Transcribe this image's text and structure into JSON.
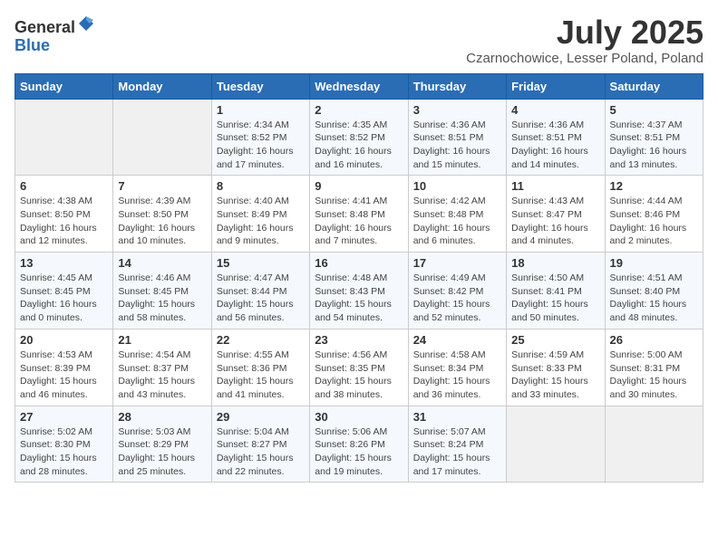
{
  "header": {
    "logo_general": "General",
    "logo_blue": "Blue",
    "month": "July 2025",
    "location": "Czarnochowice, Lesser Poland, Poland"
  },
  "days_of_week": [
    "Sunday",
    "Monday",
    "Tuesday",
    "Wednesday",
    "Thursday",
    "Friday",
    "Saturday"
  ],
  "weeks": [
    [
      {
        "day": "",
        "empty": true
      },
      {
        "day": "",
        "empty": true
      },
      {
        "day": "1",
        "sunrise": "Sunrise: 4:34 AM",
        "sunset": "Sunset: 8:52 PM",
        "daylight": "Daylight: 16 hours and 17 minutes."
      },
      {
        "day": "2",
        "sunrise": "Sunrise: 4:35 AM",
        "sunset": "Sunset: 8:52 PM",
        "daylight": "Daylight: 16 hours and 16 minutes."
      },
      {
        "day": "3",
        "sunrise": "Sunrise: 4:36 AM",
        "sunset": "Sunset: 8:51 PM",
        "daylight": "Daylight: 16 hours and 15 minutes."
      },
      {
        "day": "4",
        "sunrise": "Sunrise: 4:36 AM",
        "sunset": "Sunset: 8:51 PM",
        "daylight": "Daylight: 16 hours and 14 minutes."
      },
      {
        "day": "5",
        "sunrise": "Sunrise: 4:37 AM",
        "sunset": "Sunset: 8:51 PM",
        "daylight": "Daylight: 16 hours and 13 minutes."
      }
    ],
    [
      {
        "day": "6",
        "sunrise": "Sunrise: 4:38 AM",
        "sunset": "Sunset: 8:50 PM",
        "daylight": "Daylight: 16 hours and 12 minutes."
      },
      {
        "day": "7",
        "sunrise": "Sunrise: 4:39 AM",
        "sunset": "Sunset: 8:50 PM",
        "daylight": "Daylight: 16 hours and 10 minutes."
      },
      {
        "day": "8",
        "sunrise": "Sunrise: 4:40 AM",
        "sunset": "Sunset: 8:49 PM",
        "daylight": "Daylight: 16 hours and 9 minutes."
      },
      {
        "day": "9",
        "sunrise": "Sunrise: 4:41 AM",
        "sunset": "Sunset: 8:48 PM",
        "daylight": "Daylight: 16 hours and 7 minutes."
      },
      {
        "day": "10",
        "sunrise": "Sunrise: 4:42 AM",
        "sunset": "Sunset: 8:48 PM",
        "daylight": "Daylight: 16 hours and 6 minutes."
      },
      {
        "day": "11",
        "sunrise": "Sunrise: 4:43 AM",
        "sunset": "Sunset: 8:47 PM",
        "daylight": "Daylight: 16 hours and 4 minutes."
      },
      {
        "day": "12",
        "sunrise": "Sunrise: 4:44 AM",
        "sunset": "Sunset: 8:46 PM",
        "daylight": "Daylight: 16 hours and 2 minutes."
      }
    ],
    [
      {
        "day": "13",
        "sunrise": "Sunrise: 4:45 AM",
        "sunset": "Sunset: 8:45 PM",
        "daylight": "Daylight: 16 hours and 0 minutes."
      },
      {
        "day": "14",
        "sunrise": "Sunrise: 4:46 AM",
        "sunset": "Sunset: 8:45 PM",
        "daylight": "Daylight: 15 hours and 58 minutes."
      },
      {
        "day": "15",
        "sunrise": "Sunrise: 4:47 AM",
        "sunset": "Sunset: 8:44 PM",
        "daylight": "Daylight: 15 hours and 56 minutes."
      },
      {
        "day": "16",
        "sunrise": "Sunrise: 4:48 AM",
        "sunset": "Sunset: 8:43 PM",
        "daylight": "Daylight: 15 hours and 54 minutes."
      },
      {
        "day": "17",
        "sunrise": "Sunrise: 4:49 AM",
        "sunset": "Sunset: 8:42 PM",
        "daylight": "Daylight: 15 hours and 52 minutes."
      },
      {
        "day": "18",
        "sunrise": "Sunrise: 4:50 AM",
        "sunset": "Sunset: 8:41 PM",
        "daylight": "Daylight: 15 hours and 50 minutes."
      },
      {
        "day": "19",
        "sunrise": "Sunrise: 4:51 AM",
        "sunset": "Sunset: 8:40 PM",
        "daylight": "Daylight: 15 hours and 48 minutes."
      }
    ],
    [
      {
        "day": "20",
        "sunrise": "Sunrise: 4:53 AM",
        "sunset": "Sunset: 8:39 PM",
        "daylight": "Daylight: 15 hours and 46 minutes."
      },
      {
        "day": "21",
        "sunrise": "Sunrise: 4:54 AM",
        "sunset": "Sunset: 8:37 PM",
        "daylight": "Daylight: 15 hours and 43 minutes."
      },
      {
        "day": "22",
        "sunrise": "Sunrise: 4:55 AM",
        "sunset": "Sunset: 8:36 PM",
        "daylight": "Daylight: 15 hours and 41 minutes."
      },
      {
        "day": "23",
        "sunrise": "Sunrise: 4:56 AM",
        "sunset": "Sunset: 8:35 PM",
        "daylight": "Daylight: 15 hours and 38 minutes."
      },
      {
        "day": "24",
        "sunrise": "Sunrise: 4:58 AM",
        "sunset": "Sunset: 8:34 PM",
        "daylight": "Daylight: 15 hours and 36 minutes."
      },
      {
        "day": "25",
        "sunrise": "Sunrise: 4:59 AM",
        "sunset": "Sunset: 8:33 PM",
        "daylight": "Daylight: 15 hours and 33 minutes."
      },
      {
        "day": "26",
        "sunrise": "Sunrise: 5:00 AM",
        "sunset": "Sunset: 8:31 PM",
        "daylight": "Daylight: 15 hours and 30 minutes."
      }
    ],
    [
      {
        "day": "27",
        "sunrise": "Sunrise: 5:02 AM",
        "sunset": "Sunset: 8:30 PM",
        "daylight": "Daylight: 15 hours and 28 minutes."
      },
      {
        "day": "28",
        "sunrise": "Sunrise: 5:03 AM",
        "sunset": "Sunset: 8:29 PM",
        "daylight": "Daylight: 15 hours and 25 minutes."
      },
      {
        "day": "29",
        "sunrise": "Sunrise: 5:04 AM",
        "sunset": "Sunset: 8:27 PM",
        "daylight": "Daylight: 15 hours and 22 minutes."
      },
      {
        "day": "30",
        "sunrise": "Sunrise: 5:06 AM",
        "sunset": "Sunset: 8:26 PM",
        "daylight": "Daylight: 15 hours and 19 minutes."
      },
      {
        "day": "31",
        "sunrise": "Sunrise: 5:07 AM",
        "sunset": "Sunset: 8:24 PM",
        "daylight": "Daylight: 15 hours and 17 minutes."
      },
      {
        "day": "",
        "empty": true
      },
      {
        "day": "",
        "empty": true
      }
    ]
  ]
}
